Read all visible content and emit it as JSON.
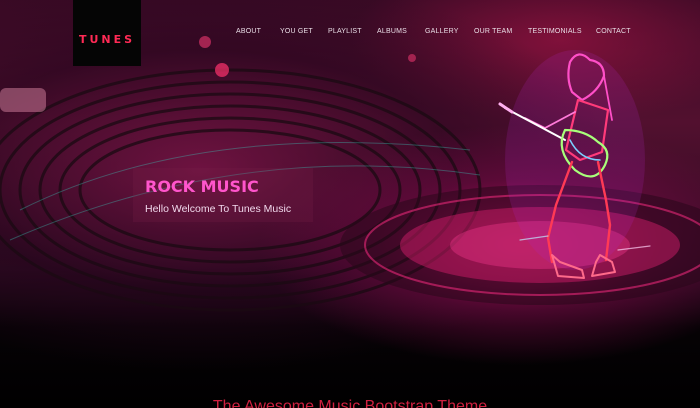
{
  "brand": {
    "logo": "TUNES",
    "accent": "#ff2a55"
  },
  "nav": {
    "items": [
      {
        "label": "ABOUT"
      },
      {
        "label": "YOU GET"
      },
      {
        "label": "PLAYLIST"
      },
      {
        "label": "ALBUMS"
      },
      {
        "label": "GALLERY"
      },
      {
        "label": "OUR TEAM"
      },
      {
        "label": "TESTIMONIALS"
      },
      {
        "label": "CONTACT"
      }
    ]
  },
  "hero": {
    "title": "ROCK MUSIC",
    "subtitle": "Hello Welcome To Tunes Music",
    "title_color": "#ff55cc"
  },
  "section": {
    "heading": "The Awesome Music Bootstrap Theme",
    "heading_color": "#d02040"
  },
  "icons": [
    "turntable-record-image",
    "neon-guitarist-image"
  ]
}
